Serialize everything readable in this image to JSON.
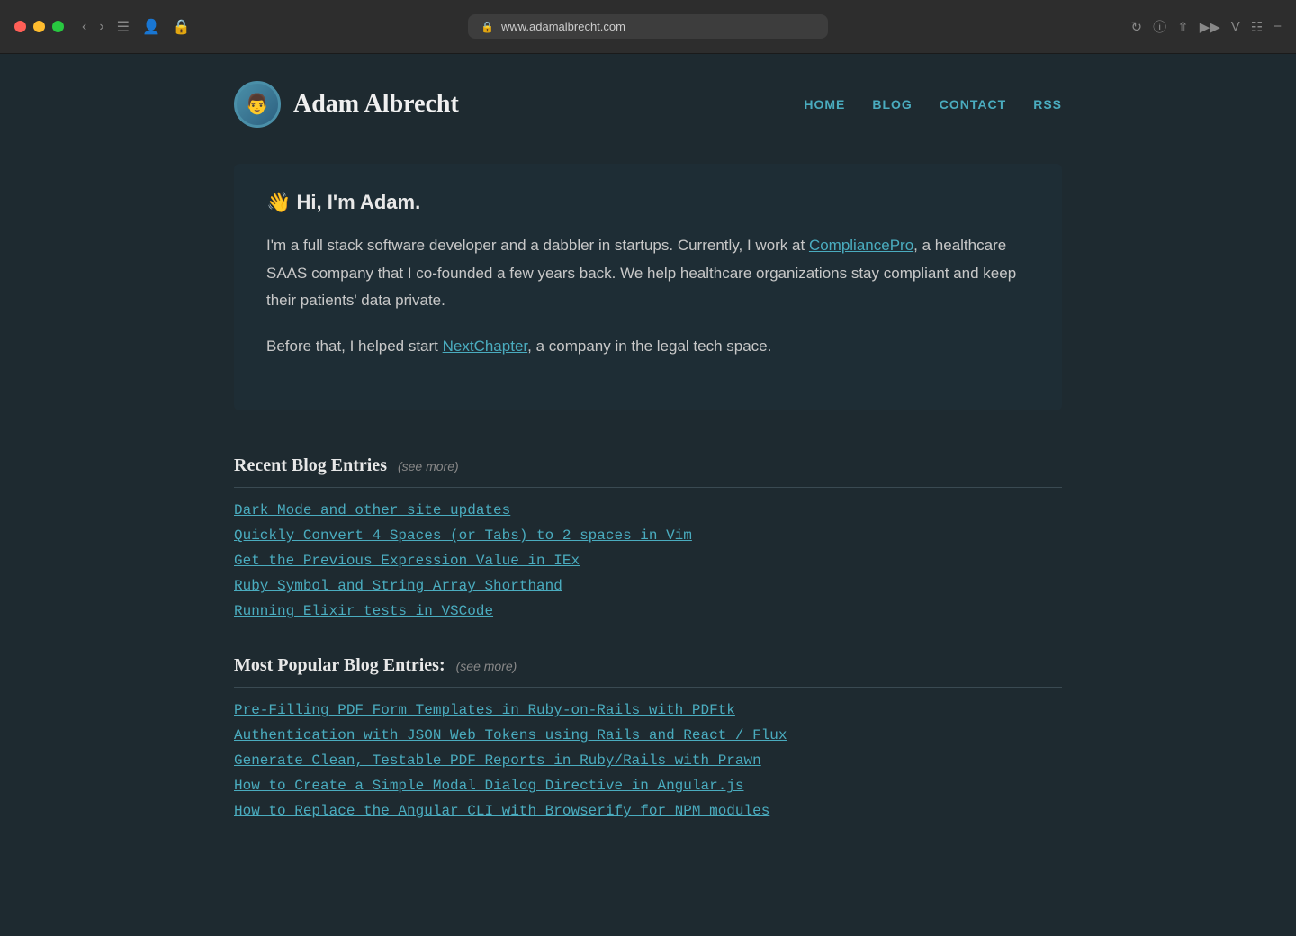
{
  "window": {
    "url": "www.adamalbrecht.com"
  },
  "nav": {
    "home": "HOME",
    "blog": "BLOG",
    "contact": "CONTACT",
    "rss": "RSS"
  },
  "header": {
    "site_title": "Adam Albrecht",
    "avatar_emoji": "👨"
  },
  "intro": {
    "greeting_emoji": "👋",
    "greeting_text": "Hi, I'm Adam.",
    "bio_p1_before": "I'm a full stack software developer and a dabbler in startups. Currently, I work at ",
    "bio_link1": "CompliancePro",
    "bio_p1_after": ", a healthcare SAAS company that I co-founded a few years back. We help healthcare organizations stay compliant and keep their patients' data private.",
    "bio_p2_before": "Before that, I helped start ",
    "bio_link2": "NextChapter",
    "bio_p2_after": ", a company in the legal tech space."
  },
  "recent_blog": {
    "title": "Recent Blog Entries",
    "see_more": "(see more)",
    "entries": [
      "Dark Mode and other site updates",
      "Quickly Convert 4 Spaces (or Tabs) to 2 spaces in Vim",
      "Get the Previous Expression Value in IEx",
      "Ruby Symbol and String Array Shorthand",
      "Running Elixir tests in VSCode"
    ]
  },
  "popular_blog": {
    "title": "Most Popular Blog Entries:",
    "see_more": "(see more)",
    "entries": [
      "Pre-Filling PDF Form Templates in Ruby-on-Rails with PDFtk",
      "Authentication with JSON Web Tokens using Rails and React / Flux",
      "Generate Clean, Testable PDF Reports in Ruby/Rails with Prawn",
      "How to Create a Simple Modal Dialog Directive in Angular.js",
      "How to Replace the Angular CLI with Browserify for NPM modules"
    ]
  }
}
